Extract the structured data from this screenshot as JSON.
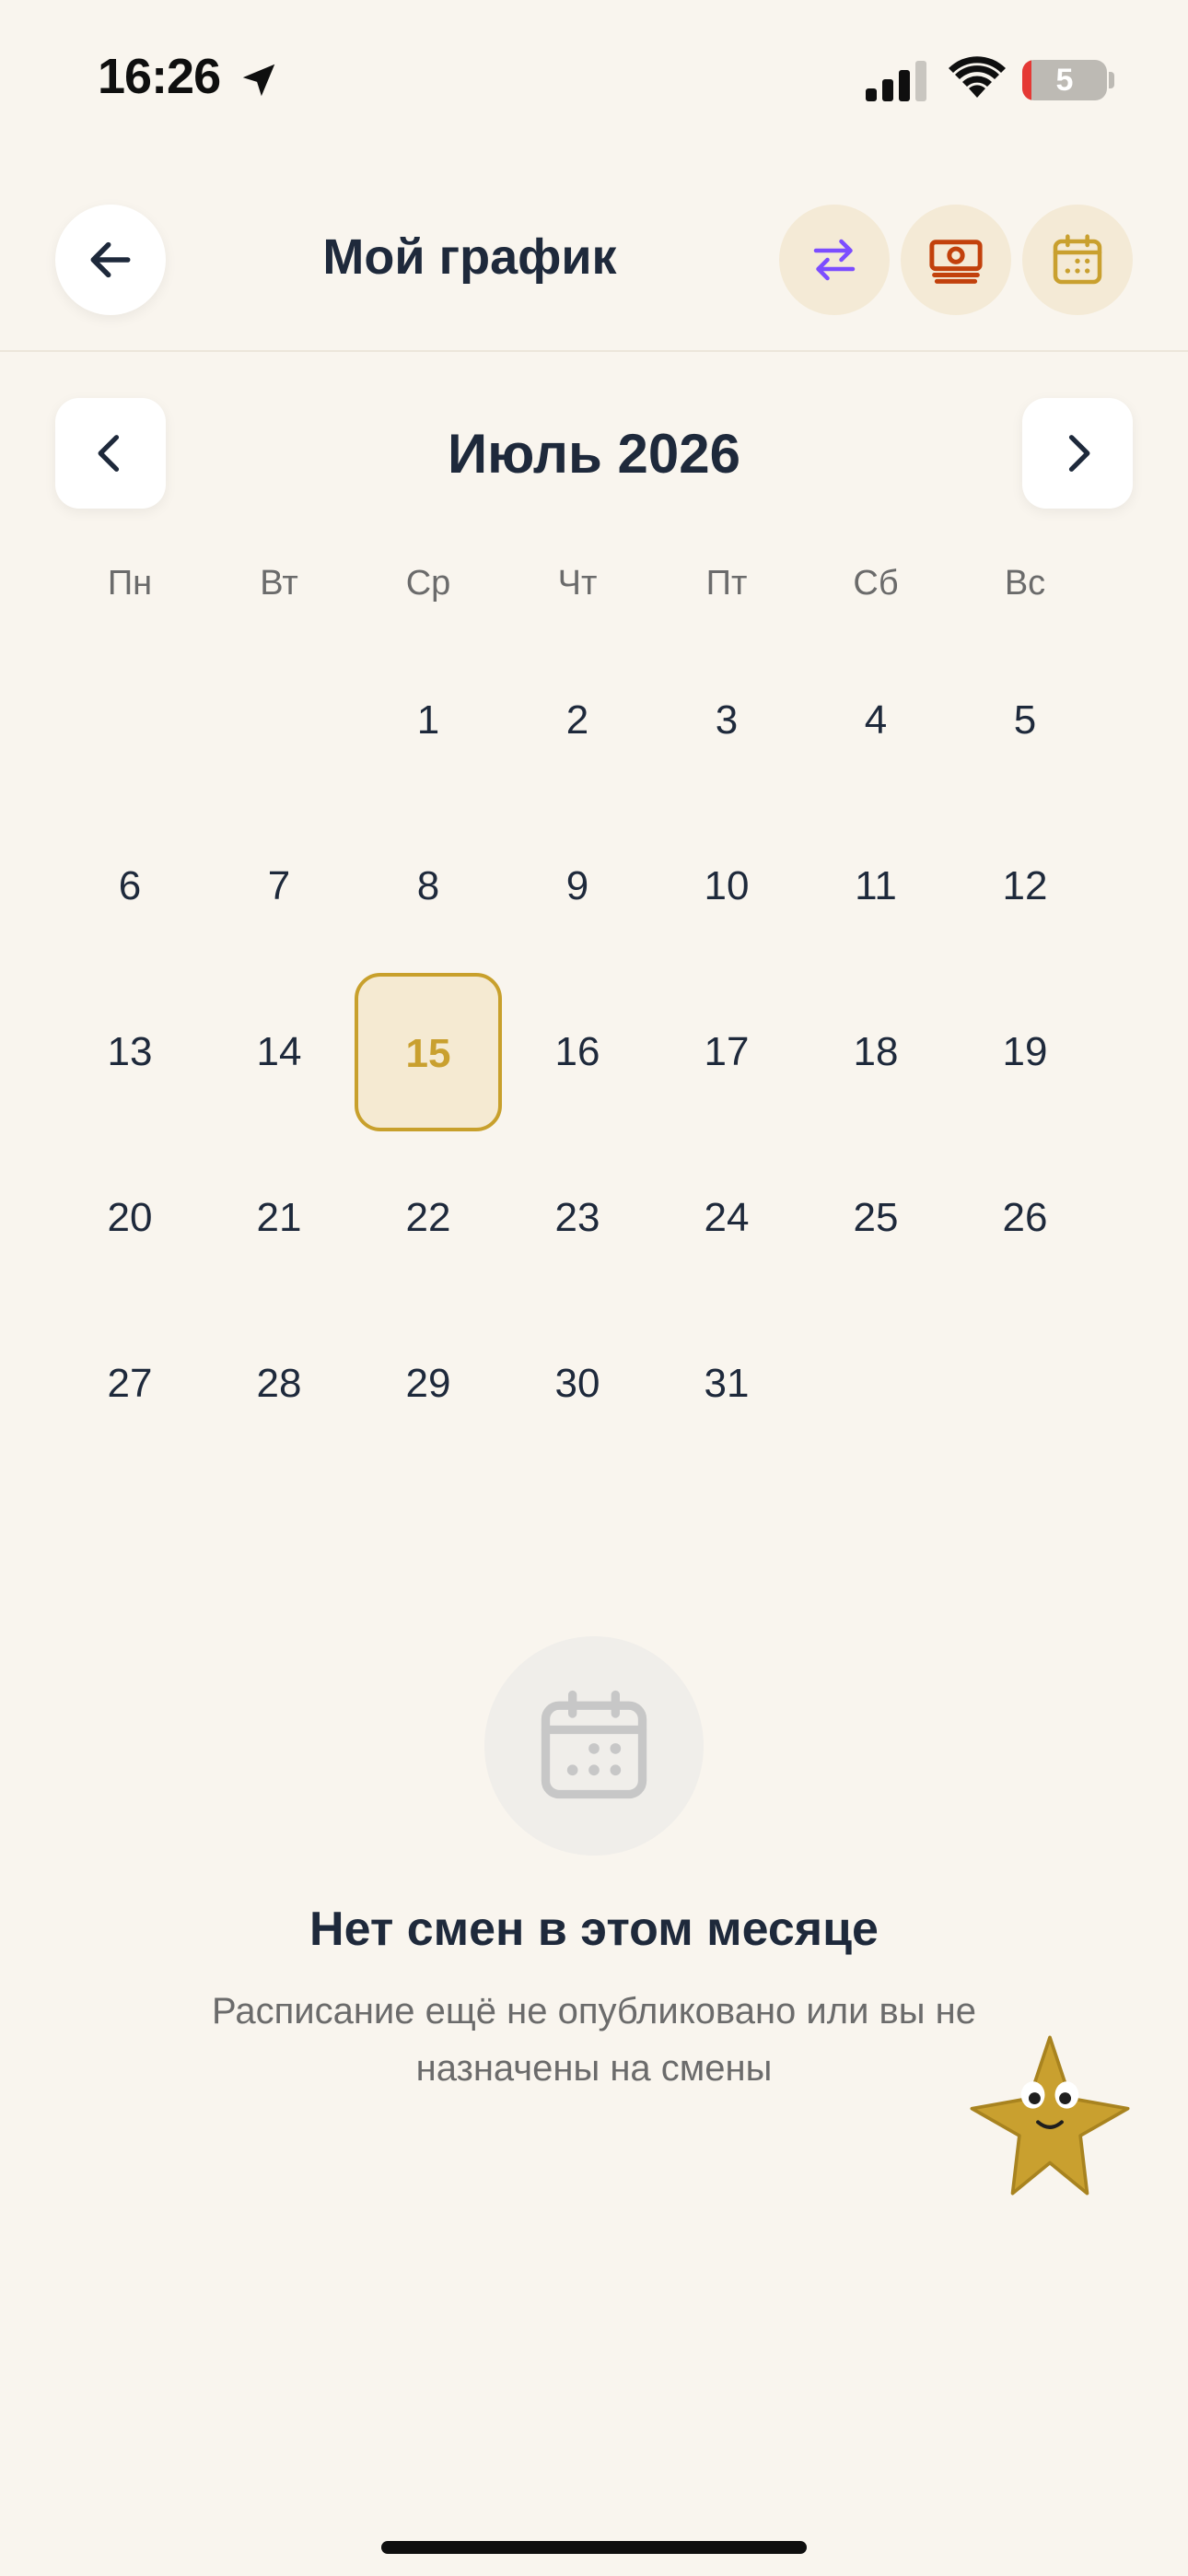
{
  "status_bar": {
    "time": "16:26",
    "battery_level": "5",
    "icons": [
      "location-arrow-icon",
      "cellular-signal-icon",
      "wifi-icon",
      "battery-icon"
    ]
  },
  "header": {
    "title": "Мой график",
    "back_icon": "arrow-left-icon",
    "actions": [
      "swap-icon",
      "money-icon",
      "calendar-icon"
    ]
  },
  "calendar": {
    "month_title": "Июль 2026",
    "weekdays": [
      "Пн",
      "Вт",
      "Ср",
      "Чт",
      "Пт",
      "Сб",
      "Вс"
    ],
    "days": [
      "1",
      "2",
      "3",
      "4",
      "5",
      "6",
      "7",
      "8",
      "9",
      "10",
      "11",
      "12",
      "13",
      "14",
      "15",
      "16",
      "17",
      "18",
      "19",
      "20",
      "21",
      "22",
      "23",
      "24",
      "25",
      "26",
      "27",
      "28",
      "29",
      "30",
      "31"
    ],
    "first_weekday_index": 2,
    "today": "15"
  },
  "empty_state": {
    "icon": "calendar-icon",
    "title": "Нет смен в этом месяце",
    "subtitle": "Расписание ещё не опубликовано или вы не назначены на смены"
  },
  "colors": {
    "background": "#f9f5ee",
    "accent": "#c9a02f",
    "swap_icon": "#7c4dff",
    "money_icon": "#c2410c",
    "text_primary": "#1e293b",
    "text_secondary": "#6b6b6b"
  }
}
